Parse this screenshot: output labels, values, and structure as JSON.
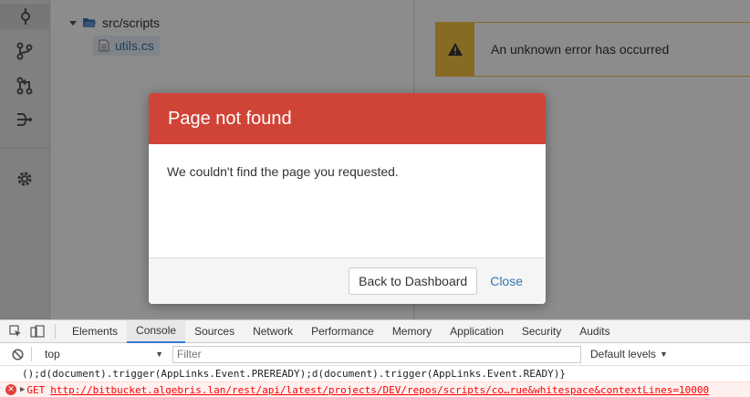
{
  "sidebar": {
    "icons": [
      "commit-icon",
      "branch-icon",
      "pull-request-icon",
      "fork-icon",
      "settings-icon"
    ]
  },
  "tree": {
    "folder_label": "src/scripts",
    "file_label": "utils.cs"
  },
  "banner": {
    "message": "An unknown error has occurred"
  },
  "modal": {
    "title": "Page not found",
    "body": "We couldn't find the page you requested.",
    "primary_label": "Back to Dashboard",
    "close_label": "Close"
  },
  "devtools": {
    "tabs": [
      "Elements",
      "Console",
      "Sources",
      "Network",
      "Performance",
      "Memory",
      "Application",
      "Security",
      "Audits"
    ],
    "active_tab": "Console",
    "context": "top",
    "filter_placeholder": "Filter",
    "levels_label": "Default levels",
    "log_line": "();d(document).trigger(AppLinks.Event.PREREADY);d(document).trigger(AppLinks.Event.READY)}",
    "error_method": "GET",
    "error_url": "http://bitbucket.algebris.lan/rest/api/latest/projects/DEV/repos/scripts/co…rue&whitespace&contextLines=10000"
  },
  "colors": {
    "modal_header": "#d04437",
    "link": "#3b73af",
    "warning": "#f6c342"
  }
}
